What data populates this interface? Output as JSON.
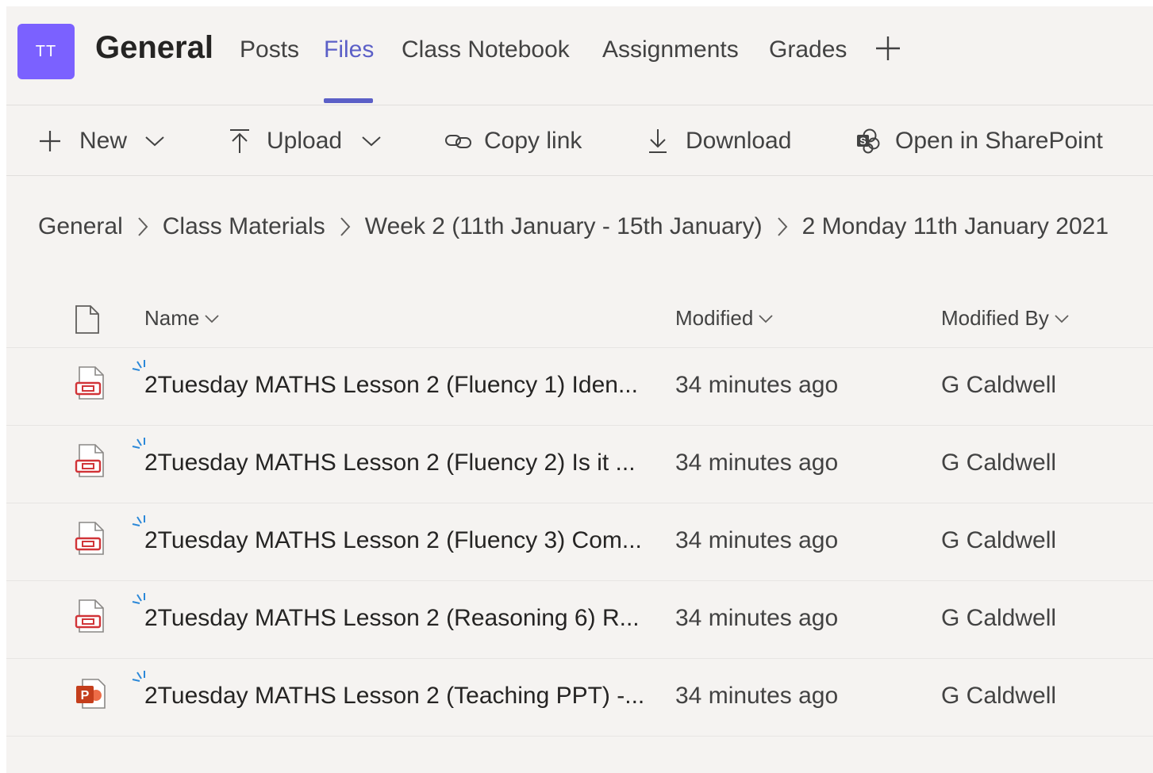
{
  "header": {
    "team_initials": "TT",
    "channel_name": "General",
    "tabs": [
      {
        "label": "Posts",
        "active": false
      },
      {
        "label": "Files",
        "active": true
      },
      {
        "label": "Class Notebook",
        "active": false
      },
      {
        "label": "Assignments",
        "active": false
      },
      {
        "label": "Grades",
        "active": false
      }
    ],
    "accent_color": "#5b5fc7",
    "avatar_color": "#7b61ff"
  },
  "toolbar": {
    "new_label": "New",
    "upload_label": "Upload",
    "copy_link_label": "Copy link",
    "download_label": "Download",
    "open_sharepoint_label": "Open in SharePoint"
  },
  "breadcrumb": [
    "General",
    "Class Materials",
    "Week 2 (11th January - 15th January)",
    "2 Monday 11th January 2021"
  ],
  "list": {
    "columns": {
      "name": "Name",
      "modified": "Modified",
      "modified_by": "Modified By"
    },
    "rows": [
      {
        "type": "pdf-icon",
        "name": "2Tuesday MATHS Lesson 2 (Fluency 1) Iden...",
        "modified": "34 minutes ago",
        "modified_by": "G Caldwell"
      },
      {
        "type": "pdf-icon",
        "name": "2Tuesday MATHS Lesson 2 (Fluency 2) Is it ...",
        "modified": "34 minutes ago",
        "modified_by": "G Caldwell"
      },
      {
        "type": "pdf-icon",
        "name": "2Tuesday MATHS Lesson 2 (Fluency 3) Com...",
        "modified": "34 minutes ago",
        "modified_by": "G Caldwell"
      },
      {
        "type": "pdf-icon",
        "name": "2Tuesday MATHS Lesson 2 (Reasoning 6) R...",
        "modified": "34 minutes ago",
        "modified_by": "G Caldwell"
      },
      {
        "type": "powerpoint-icon",
        "name": "2Tuesday MATHS Lesson 2 (Teaching PPT) -...",
        "modified": "34 minutes ago",
        "modified_by": "G Caldwell"
      }
    ]
  }
}
